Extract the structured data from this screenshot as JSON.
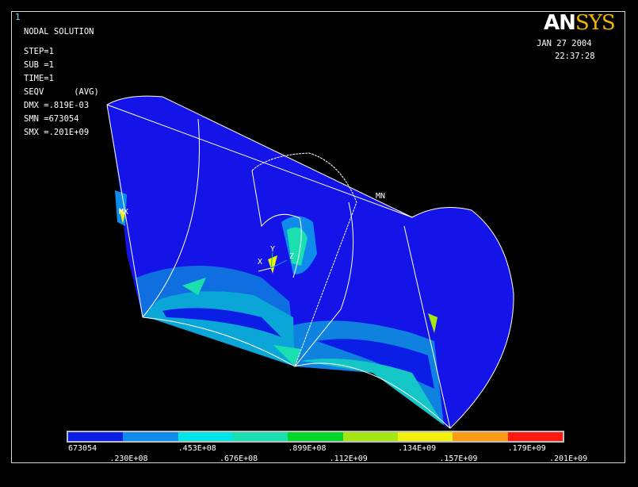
{
  "window_number": "1",
  "solution": {
    "title": "NODAL SOLUTION",
    "step": "STEP=1",
    "sub": "SUB =1",
    "time": "TIME=1",
    "seqv": "SEQV      (AVG)",
    "dmx": "DMX =.819E-03",
    "smn": "SMN =673054",
    "smx": "SMX =.201E+09"
  },
  "logo": {
    "an": "AN",
    "sys": "SYS"
  },
  "date": "JAN 27 2004",
  "time": "22:37:28",
  "markers": {
    "mn": "MN",
    "mx": "MX"
  },
  "triad": {
    "x": "X",
    "y": "Y",
    "z": "Z"
  },
  "legend": {
    "colors": [
      "#0a1ee6",
      "#0f8ceb",
      "#00e6e6",
      "#1ae0b0",
      "#00d62a",
      "#a6e612",
      "#f2f00d",
      "#ff9a14",
      "#ff1a10"
    ],
    "values_bottom": [
      "673054",
      ".453E+08",
      ".899E+08",
      ".134E+09",
      ".179E+09"
    ],
    "values_top": [
      ".230E+08",
      ".676E+08",
      ".112E+09",
      ".157E+09",
      ".201E+09"
    ]
  }
}
